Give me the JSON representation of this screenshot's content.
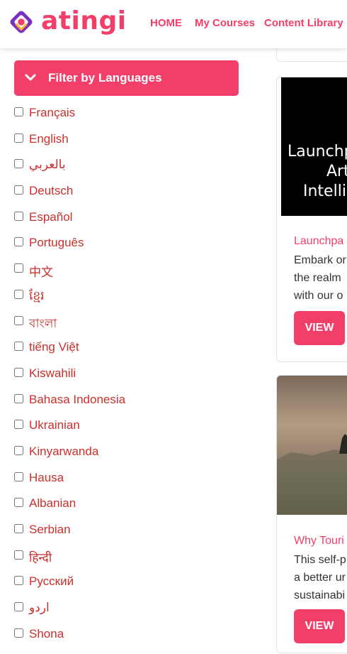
{
  "header": {
    "logo_text": "atingi",
    "nav": [
      "HOME",
      "My Courses",
      "Content Library"
    ]
  },
  "filter": {
    "label": "Filter by Languages",
    "languages": [
      "Français",
      "English",
      "بالعربي",
      "Deutsch",
      "Español",
      "Português",
      "中文",
      "ខ្មែរ",
      "বাংলা",
      "tiếng Việt",
      "Kiswahili",
      "Bahasa Indonesia",
      "Ukrainian",
      "Kinyarwanda",
      "Hausa",
      "Albanian",
      "Serbian",
      "हिन्दी",
      "Русский",
      "اردو",
      "Shona"
    ]
  },
  "cards": [
    {
      "image_lines": [
        "Launchp",
        "Art",
        "Intellig"
      ],
      "title": "Launchpa",
      "desc": [
        "Embark or",
        "the realm",
        "with our o"
      ],
      "button": "VIEW"
    },
    {
      "title": "Why Touri",
      "desc": [
        "This self-p",
        "a better ur",
        "sustainabi"
      ],
      "button": "VIEW"
    }
  ],
  "colors": {
    "brand": "#f23f6a",
    "link_red": "#c9302c"
  },
  "icons": {
    "logo": "atingi-logo-icon",
    "filter_toggle": "chevron-down-icon"
  }
}
